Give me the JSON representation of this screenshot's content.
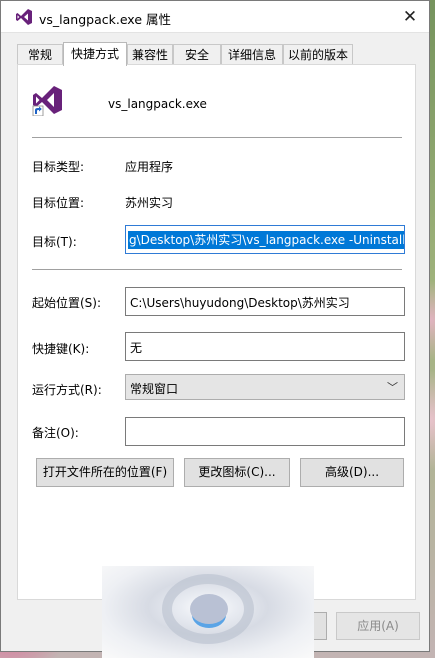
{
  "window": {
    "title": "vs_langpack.exe 属性",
    "close_glyph": "✕",
    "app_icon": "visual-studio-icon"
  },
  "tabs": [
    {
      "label": "常规",
      "active": false
    },
    {
      "label": "快捷方式",
      "active": true
    },
    {
      "label": "兼容性",
      "active": false
    },
    {
      "label": "安全",
      "active": false
    },
    {
      "label": "详细信息",
      "active": false
    },
    {
      "label": "以前的版本",
      "active": false
    }
  ],
  "shortcut": {
    "name": "vs_langpack.exe",
    "icon": "visual-studio-shortcut-icon",
    "target_type_label": "目标类型:",
    "target_type_value": "应用程序",
    "target_location_label": "目标位置:",
    "target_location_value": "苏州实习",
    "target_label": "目标(T):",
    "target_value": "g\\Desktop\\苏州实习\\vs_langpack.exe -Uninstall",
    "start_in_label": "起始位置(S):",
    "start_in_value": "C:\\Users\\huyudong\\Desktop\\苏州实习",
    "hotkey_label": "快捷键(K):",
    "hotkey_value": "无",
    "run_label": "运行方式(R):",
    "run_value": "常规窗口",
    "comment_label": "备注(O):",
    "comment_value": ""
  },
  "buttons": {
    "open_location": "打开文件所在的位置(F)",
    "change_icon": "更改图标(C)...",
    "advanced": "高级(D)...",
    "apply": "应用(A)"
  },
  "colors": {
    "selection": "#0078d7",
    "vs_purple": "#68217a"
  }
}
